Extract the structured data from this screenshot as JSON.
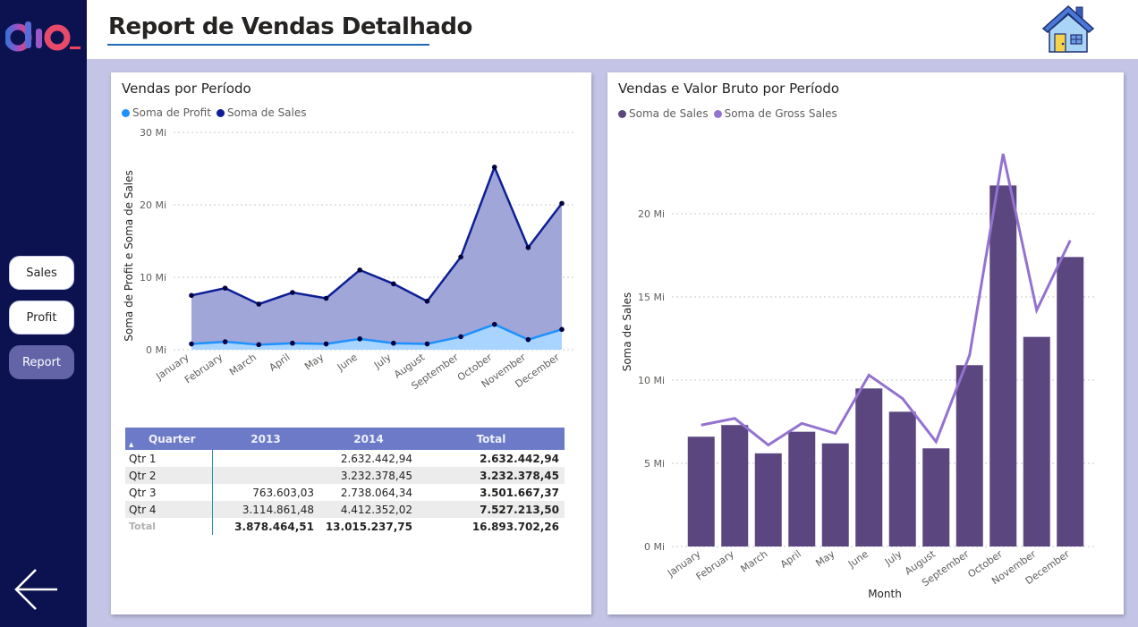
{
  "header": {
    "title": "Report de Vendas Detalhado"
  },
  "sidebar": {
    "logo": "dio",
    "nav": [
      {
        "label": "Sales"
      },
      {
        "label": "Profit"
      },
      {
        "label": "Report",
        "active": true
      }
    ]
  },
  "icons": {
    "home": "home-icon",
    "back": "back-arrow-icon"
  },
  "colors": {
    "sidebar": "#0c1250",
    "canvas": "#c3c4e6",
    "accent": "#6264a7",
    "sales_line": "#0e1f96",
    "profit_line": "#1e90ff",
    "bar": "#5b4680",
    "gross_line": "#9372d0"
  },
  "left_chart": {
    "title": "Vendas por Período",
    "legend": [
      "Soma de Profit",
      "Soma de  Sales"
    ],
    "ylabel": "Soma de Profit e Soma de Sales",
    "yticks": [
      "0 Mi",
      "10 Mi",
      "20 Mi",
      "30 Mi"
    ]
  },
  "right_chart": {
    "title": "Vendas e Valor Bruto por Período",
    "legend": [
      "Soma de  Sales",
      "Soma de Gross Sales"
    ],
    "ylabel": "Soma de Sales",
    "xlabel": "Month",
    "yticks": [
      "0 Mi",
      "5 Mi",
      "10 Mi",
      "15 Mi",
      "20 Mi"
    ]
  },
  "chart_data": [
    {
      "type": "area",
      "title": "Vendas por Período",
      "categories": [
        "January",
        "February",
        "March",
        "April",
        "May",
        "June",
        "July",
        "August",
        "September",
        "October",
        "November",
        "December"
      ],
      "series": [
        {
          "name": "Soma de Profit",
          "values": [
            0.8,
            1.1,
            0.7,
            0.9,
            0.8,
            1.5,
            0.9,
            0.8,
            1.8,
            3.5,
            1.4,
            2.8
          ]
        },
        {
          "name": "Soma de  Sales",
          "values": [
            7.5,
            8.5,
            6.3,
            7.9,
            7.1,
            11.0,
            9.1,
            6.7,
            12.8,
            25.2,
            14.1,
            20.2
          ]
        }
      ],
      "ylabel": "Soma de Profit e Soma de Sales",
      "ylim": [
        0,
        30
      ],
      "grid": true,
      "legend": "top-left"
    },
    {
      "type": "bar",
      "title": "Vendas e Valor Bruto por Período",
      "categories": [
        "January",
        "February",
        "March",
        "April",
        "May",
        "June",
        "July",
        "August",
        "September",
        "October",
        "November",
        "December"
      ],
      "series": [
        {
          "name": "Soma de  Sales",
          "type": "bar",
          "values": [
            6.6,
            7.3,
            5.6,
            6.9,
            6.2,
            9.5,
            8.1,
            5.9,
            10.9,
            21.7,
            12.6,
            17.4
          ]
        },
        {
          "name": "Soma de Gross Sales",
          "type": "line",
          "values": [
            7.3,
            7.7,
            6.1,
            7.4,
            6.8,
            10.3,
            8.9,
            6.3,
            11.5,
            23.6,
            14.2,
            18.4
          ]
        }
      ],
      "xlabel": "Month",
      "ylabel": "Soma de Sales",
      "ylim": [
        0,
        24
      ],
      "grid": true,
      "legend": "top-left"
    }
  ],
  "matrix": {
    "headers": [
      "Quarter",
      "2013",
      "2014",
      "Total"
    ],
    "rows": [
      {
        "label": "Qtr 1",
        "y2013": "",
        "y2014": "2.632.442,94",
        "total": "2.632.442,94"
      },
      {
        "label": "Qtr 2",
        "y2013": "",
        "y2014": "3.232.378,45",
        "total": "3.232.378,45"
      },
      {
        "label": "Qtr 3",
        "y2013": "763.603,03",
        "y2014": "2.738.064,34",
        "total": "3.501.667,37"
      },
      {
        "label": "Qtr 4",
        "y2013": "3.114.861,48",
        "y2014": "4.412.352,02",
        "total": "7.527.213,50"
      }
    ],
    "total": {
      "label": "Total",
      "y2013": "3.878.464,51",
      "y2014": "13.015.237,75",
      "total": "16.893.702,26"
    }
  }
}
